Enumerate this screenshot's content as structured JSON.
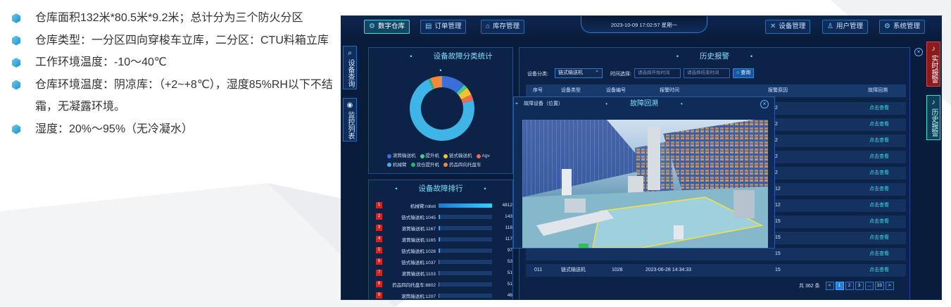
{
  "bullets": [
    "仓库面积132米*80.5米*9.2米；总计分为三个防火分区",
    "仓库类型：一分区四向穿梭车立库，二分区：CTU料箱立库",
    "工作环境温度：-10～40℃",
    "仓库环境温度：阴凉库：（+2~+8℃），湿度85%RH以下不结霜，无凝露环境。",
    "湿度：20%～95%（无冷凝水）"
  ],
  "app": {
    "nav": {
      "digital_warehouse": "数字仓库",
      "order_mgmt": "订单管理",
      "inventory_mgmt": "库存管理",
      "device_mgmt": "设备管理",
      "user_mgmt": "用户管理",
      "system_mgmt": "系统管理"
    },
    "clock": "2023-10-09 17:02:57 星期一",
    "left_tabs": {
      "device_query": "设备查询",
      "monitor_list": "监控列表"
    },
    "right_tabs": {
      "realtime_alarm": "实时报警",
      "history_alarm": "历史报警"
    },
    "fault_category": {
      "title": "设备故障分类统计",
      "legend": [
        "滚筒输送机",
        "提升机",
        "链式输送机",
        "Agv",
        "机械臂",
        "双仓提升机",
        "药品四向托盘车"
      ],
      "colors": [
        "#3b6fd8",
        "#3ed08b",
        "#f1c232",
        "#f06a4a",
        "#3fb4e6",
        "#22b573",
        "#f08a3a"
      ],
      "values": [
        12,
        2,
        4,
        3,
        72,
        1,
        6
      ]
    },
    "fault_rank": {
      "title": "设备故障排行",
      "items": [
        {
          "no": "1",
          "name": "机械臂:robot",
          "value": "4812",
          "fill": 1.0
        },
        {
          "no": "2",
          "name": "链式输送机:1045",
          "value": "143",
          "fill": 0.03
        },
        {
          "no": "3",
          "name": "滚筒输送机:1167",
          "value": "118",
          "fill": 0.025
        },
        {
          "no": "4",
          "name": "滚筒输送机:1165",
          "value": "117",
          "fill": 0.024
        },
        {
          "no": "5",
          "name": "链式输送机:1028",
          "value": "97",
          "fill": 0.02
        },
        {
          "no": "6",
          "name": "链式输送机:1037",
          "value": "53",
          "fill": 0.011
        },
        {
          "no": "7",
          "name": "滚筒输送机:1103",
          "value": "51",
          "fill": 0.011
        },
        {
          "no": "8",
          "name": "药品四向托盘车:8802",
          "value": "51",
          "fill": 0.011
        },
        {
          "no": "9",
          "name": "滚筒输送机:1207",
          "value": "46",
          "fill": 0.01
        }
      ]
    },
    "history": {
      "title": "历史报警",
      "device_category_label": "设备分类:",
      "device_category_value": "链式输送机",
      "time_label": "时间选择:",
      "start_placeholder": "请选择开始时间",
      "end_placeholder": "请选择结束时间",
      "query": "查询",
      "headers": [
        "序号",
        "设备类型",
        "设备编号",
        "报警时间",
        "报警原因",
        "故障回溯"
      ],
      "visible_reasons": [
        "2",
        "2",
        "2",
        "2",
        "2",
        "12",
        "12",
        "15",
        "15",
        "15"
      ],
      "link_text": "点击查看",
      "last_row": {
        "no": "011",
        "type": "链式输送机",
        "code": "1028",
        "time": "2023-06-28 14:34:33",
        "reason": "15",
        "link": "点击查看"
      },
      "total": "共 362 条",
      "pages": [
        "<",
        "1",
        "2",
        "3",
        "...",
        "33",
        ">"
      ]
    },
    "modal": {
      "device_label": "故障设备（位置）",
      "title": "故障回溯"
    }
  }
}
